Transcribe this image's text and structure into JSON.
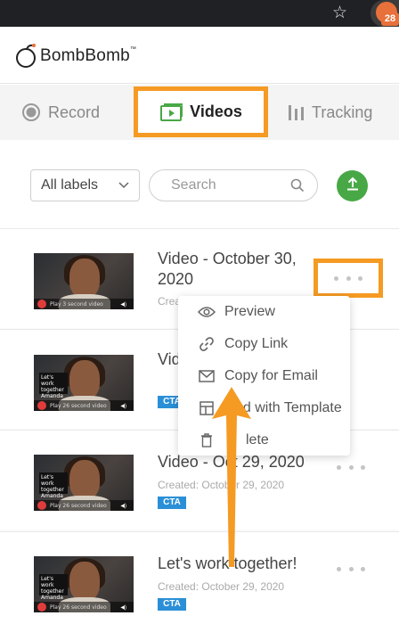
{
  "browser": {
    "extension_badge": "28"
  },
  "brand": {
    "name": "BombBomb",
    "trademark": "™"
  },
  "tabs": [
    {
      "label": "Record",
      "icon": "record-icon"
    },
    {
      "label": "Videos",
      "icon": "video-play-icon",
      "active": true
    },
    {
      "label": "Tracking",
      "icon": "bars-icon"
    }
  ],
  "filters": {
    "labels_value": "All labels",
    "search_placeholder": "Search"
  },
  "videos": [
    {
      "title": "Video - October 30, 2020",
      "created": "Create",
      "has_cta": false
    },
    {
      "title": "Vid",
      "created": "",
      "cta": "CTA"
    },
    {
      "title": "Video - Oct 29, 2020",
      "created": "Created: October 29, 2020",
      "cta": "CTA"
    },
    {
      "title": "Let's work together!",
      "created": "Created: October 29, 2020",
      "cta": "CTA"
    }
  ],
  "thumbnail_text": {
    "bar_1": "Play 3 second video",
    "bar_2": "Play 26 second video",
    "bar_3": "Play 26 second video",
    "bar_4": "Play 26 second video",
    "sign": "Let's work together Amanda"
  },
  "menu": {
    "items": [
      {
        "label": "Preview",
        "icon": "eye-icon"
      },
      {
        "label": "Copy Link",
        "icon": "link-icon"
      },
      {
        "label": "Copy for Email",
        "icon": "envelope-icon"
      },
      {
        "label": "Send with Template",
        "display": "nd with Template",
        "icon": "template-icon"
      },
      {
        "label": "Delete",
        "display": "lete",
        "icon": "trash-icon"
      }
    ]
  },
  "colors": {
    "highlight": "#f59a23",
    "accent_green": "#48a846",
    "cta_blue": "#2a8fd6"
  }
}
